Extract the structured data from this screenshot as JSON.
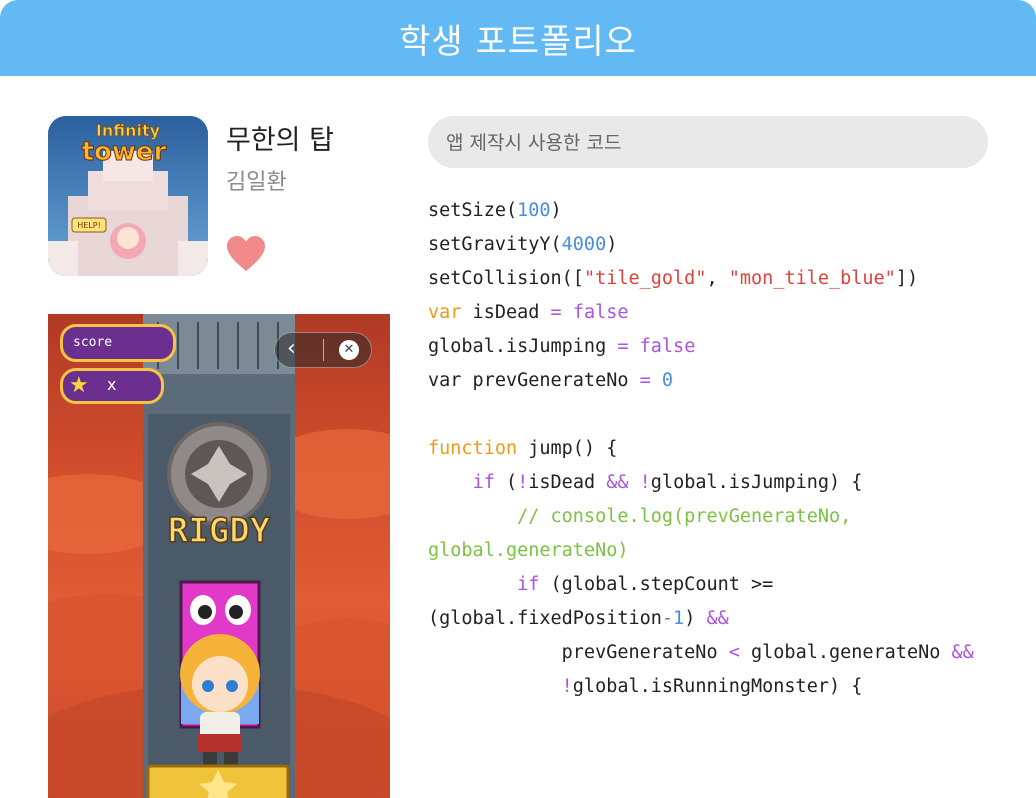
{
  "header": {
    "title": "학생 포트폴리오"
  },
  "app": {
    "name": "무한의 탑",
    "author": "김일환",
    "icon_text": {
      "line1": "Infinity",
      "line2": "tower",
      "badge": "HELP!"
    }
  },
  "game": {
    "score_label": "score",
    "star_multiplier": "x",
    "ready_text": "RIGDY"
  },
  "code_section": {
    "label": "앱 제작시 사용한 코드"
  },
  "code_lines": [
    [
      {
        "t": "setSize(",
        "c": "plain"
      },
      {
        "t": "100",
        "c": "number"
      },
      {
        "t": ")",
        "c": "plain"
      }
    ],
    [
      {
        "t": "setGravityY(",
        "c": "plain"
      },
      {
        "t": "4000",
        "c": "number"
      },
      {
        "t": ")",
        "c": "plain"
      }
    ],
    [
      {
        "t": "setCollision([",
        "c": "plain"
      },
      {
        "t": "\"tile_gold\"",
        "c": "string"
      },
      {
        "t": ", ",
        "c": "plain"
      },
      {
        "t": "\"mon_tile_blue\"",
        "c": "string"
      },
      {
        "t": "])",
        "c": "plain"
      }
    ],
    [
      {
        "t": "var",
        "c": "keyword"
      },
      {
        "t": " isDead ",
        "c": "plain"
      },
      {
        "t": "=",
        "c": "operator"
      },
      {
        "t": " ",
        "c": "plain"
      },
      {
        "t": "false",
        "c": "operator"
      }
    ],
    [
      {
        "t": "global.isJumping ",
        "c": "plain"
      },
      {
        "t": "=",
        "c": "operator"
      },
      {
        "t": " ",
        "c": "plain"
      },
      {
        "t": "false",
        "c": "operator"
      }
    ],
    [
      {
        "t": "var prevGenerateNo ",
        "c": "plain"
      },
      {
        "t": "=",
        "c": "operator"
      },
      {
        "t": " ",
        "c": "plain"
      },
      {
        "t": "0",
        "c": "number"
      }
    ],
    [],
    [
      {
        "t": "function",
        "c": "keyword"
      },
      {
        "t": " jump() {",
        "c": "plain"
      }
    ],
    [
      {
        "t": "    ",
        "c": "plain"
      },
      {
        "t": "if",
        "c": "operator"
      },
      {
        "t": " (",
        "c": "plain"
      },
      {
        "t": "!",
        "c": "operator"
      },
      {
        "t": "isDead ",
        "c": "plain"
      },
      {
        "t": "&&",
        "c": "operator"
      },
      {
        "t": " ",
        "c": "plain"
      },
      {
        "t": "!",
        "c": "operator"
      },
      {
        "t": "global.isJumping) {",
        "c": "plain"
      }
    ],
    [
      {
        "t": "        // console.log(prevGenerateNo,",
        "c": "comment"
      }
    ],
    [
      {
        "t": "global.generateNo)",
        "c": "comment"
      }
    ],
    [
      {
        "t": "        ",
        "c": "plain"
      },
      {
        "t": "if",
        "c": "operator"
      },
      {
        "t": " (global.stepCount >=",
        "c": "plain"
      }
    ],
    [
      {
        "t": "(global.fixedPosition",
        "c": "plain"
      },
      {
        "t": "-",
        "c": "operator"
      },
      {
        "t": "1",
        "c": "number"
      },
      {
        "t": ") ",
        "c": "plain"
      },
      {
        "t": "&&",
        "c": "operator"
      }
    ],
    [
      {
        "t": "            prevGenerateNo ",
        "c": "plain"
      },
      {
        "t": "<",
        "c": "operator"
      },
      {
        "t": " global.generateNo ",
        "c": "plain"
      },
      {
        "t": "&&",
        "c": "operator"
      }
    ],
    [
      {
        "t": "            ",
        "c": "plain"
      },
      {
        "t": "!",
        "c": "operator"
      },
      {
        "t": "global.isRunningMonster) {",
        "c": "plain"
      }
    ]
  ],
  "colors": {
    "header": "#63b9f4",
    "heart": "#f28a8a",
    "plain": "#222222",
    "keyword": "#ef9a1a",
    "operator": "#a855e0",
    "number": "#4a8de0",
    "string": "#e0413a",
    "comment": "#7cc242"
  }
}
